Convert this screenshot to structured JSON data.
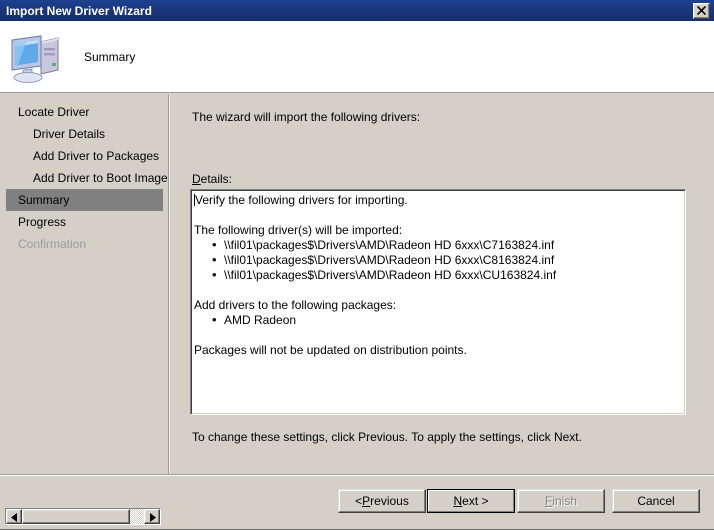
{
  "window": {
    "title": "Import New Driver Wizard",
    "close_label": "Close",
    "close_icon": "close-icon"
  },
  "header": {
    "heading": "Summary",
    "icon": "computer-icon"
  },
  "sidebar": {
    "items": [
      {
        "label": "Locate Driver",
        "level": 0,
        "state": "normal"
      },
      {
        "label": "Driver Details",
        "level": 1,
        "state": "normal"
      },
      {
        "label": "Add Driver to Packages",
        "level": 1,
        "state": "normal"
      },
      {
        "label": "Add Driver to Boot Images",
        "level": 1,
        "state": "normal"
      },
      {
        "label": "Summary",
        "level": 0,
        "state": "selected"
      },
      {
        "label": "Progress",
        "level": 0,
        "state": "normal"
      },
      {
        "label": "Confirmation",
        "level": 0,
        "state": "disabled"
      }
    ]
  },
  "main": {
    "intro": "The wizard will import the following drivers:",
    "details_label_accesskey": "D",
    "details_label_rest": "etails:",
    "details": {
      "line1": "Verify the following drivers for importing.",
      "line2": "The following driver(s) will be imported:",
      "driver_paths": [
        "\\\\fil01\\packages$\\Drivers\\AMD\\Radeon HD 6xxx\\C7163824.inf",
        "\\\\fil01\\packages$\\Drivers\\AMD\\Radeon HD 6xxx\\C8163824.inf",
        "\\\\fil01\\packages$\\Drivers\\AMD\\Radeon HD 6xxx\\CU163824.inf"
      ],
      "line3": "Add drivers to the following packages:",
      "packages": [
        "AMD Radeon"
      ],
      "line4": "Packages will not be updated on distribution points."
    },
    "footer": "To change these settings, click Previous. To apply the settings, click Next."
  },
  "buttons": {
    "previous": {
      "pre": "< ",
      "key": "P",
      "post": "revious",
      "state": "enabled"
    },
    "next": {
      "pre": "",
      "key": "N",
      "post": "ext >",
      "state": "default"
    },
    "finish": {
      "pre": "",
      "key": "F",
      "post": "inish",
      "state": "disabled"
    },
    "cancel": {
      "pre": "",
      "key": "",
      "post": "Cancel",
      "state": "enabled"
    }
  },
  "scrollbar": {
    "left_arrow_icon": "triangle-left-icon",
    "right_arrow_icon": "triangle-right-icon"
  },
  "colors": {
    "titlebar": "#1b3a80",
    "face": "#d4d0c8",
    "selection": "#808080",
    "disabled_text": "#9a9a94"
  }
}
